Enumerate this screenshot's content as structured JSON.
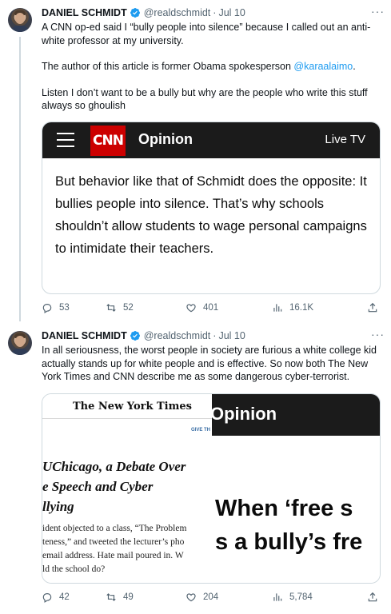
{
  "tweets": [
    {
      "name": "DANIEL SCHMIDT",
      "handle": "@realdschmidt",
      "sep": "·",
      "date": "Jul 10",
      "more": "···",
      "text_p1": "A CNN op-ed said I “bully people into silence” because I called out an anti-white professor at my university.",
      "text_p2_prefix": "The author of this article is former Obama spokesperson ",
      "text_p2_mention": "@karaalaimo",
      "text_p2_suffix": ".",
      "text_p3": "Listen I don’t want to be a bully but why are the people who write this stuff always so ghoulish",
      "card": {
        "logo": "CNN",
        "section": "Opinion",
        "live": "Live TV",
        "quote": "But behavior like that of Schmidt does the opposite: It bullies people into silence. That’s why schools shouldn’t allow students to wage personal campaigns to intimidate their teachers."
      },
      "stats": {
        "replies": "53",
        "retweets": "52",
        "likes": "401",
        "views": "16.1K"
      }
    },
    {
      "name": "DANIEL SCHMIDT",
      "handle": "@realdschmidt",
      "sep": "·",
      "date": "Jul 10",
      "more": "···",
      "text": "In all seriousness, the worst people in society are furious a white college kid actually stands up for white people and is effective. So now both The New York Times and CNN describe me as some dangerous cyber-terrorist.",
      "card": {
        "nyt_logo": "The New York Times",
        "give": "GIVE TH",
        "headline_l1": "UChicago, a Debate Over",
        "headline_l2": "e Speech and Cyber",
        "headline_l3": "llying",
        "body_l1": "ident objected to a class, “The Problem",
        "body_l2": "teness,” and tweeted the lecturer’s pho",
        "body_l3": "email address. Hate mail poured in. W",
        "body_l4": "ld the school do?",
        "cnn_section": "Opinion",
        "big_l1": "When ‘free s",
        "big_l2": "s a bully’s fre"
      },
      "stats": {
        "replies": "42",
        "retweets": "49",
        "likes": "204",
        "views": "5,784"
      }
    }
  ],
  "colors": {
    "accent": "#1d9bf0",
    "muted": "#536471",
    "cnn_red": "#cc0000",
    "dark_bar": "#1b1b1b"
  },
  "icons": [
    "verified-badge-icon",
    "reply-icon",
    "retweet-icon",
    "like-icon",
    "views-icon",
    "share-icon",
    "hamburger-menu-icon"
  ]
}
